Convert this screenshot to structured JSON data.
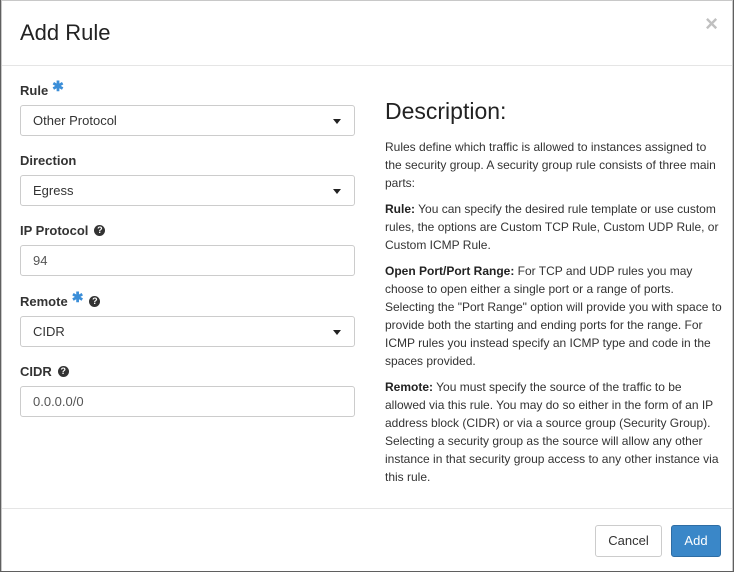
{
  "modal": {
    "title": "Add Rule",
    "close_glyph": "×"
  },
  "form": {
    "rule": {
      "label": "Rule",
      "required_mark": "✱",
      "value": "Other Protocol"
    },
    "direction": {
      "label": "Direction",
      "value": "Egress"
    },
    "ip_protocol": {
      "label": "IP Protocol",
      "help_glyph": "?",
      "value": "94"
    },
    "remote": {
      "label": "Remote",
      "required_mark": "✱",
      "help_glyph": "?",
      "value": "CIDR"
    },
    "cidr": {
      "label": "CIDR",
      "help_glyph": "?",
      "value": "0.0.0.0/0"
    }
  },
  "description": {
    "title": "Description:",
    "intro": "Rules define which traffic is allowed to instances assigned to the security group. A security group rule consists of three main parts:",
    "rule_term": "Rule:",
    "rule_text": " You can specify the desired rule template or use custom rules, the options are Custom TCP Rule, Custom UDP Rule, or Custom ICMP Rule.",
    "port_term": "Open Port/Port Range:",
    "port_text": " For TCP and UDP rules you may choose to open either a single port or a range of ports. Selecting the \"Port Range\" option will provide you with space to provide both the starting and ending ports for the range. For ICMP rules you instead specify an ICMP type and code in the spaces provided.",
    "remote_term": "Remote:",
    "remote_text": " You must specify the source of the traffic to be allowed via this rule. You may do so either in the form of an IP address block (CIDR) or via a source group (Security Group). Selecting a security group as the source will allow any other instance in that security group access to any other instance via this rule."
  },
  "footer": {
    "cancel_label": "Cancel",
    "add_label": "Add"
  },
  "colors": {
    "primary": "#3a87c8",
    "required": "#3b8ed8"
  }
}
